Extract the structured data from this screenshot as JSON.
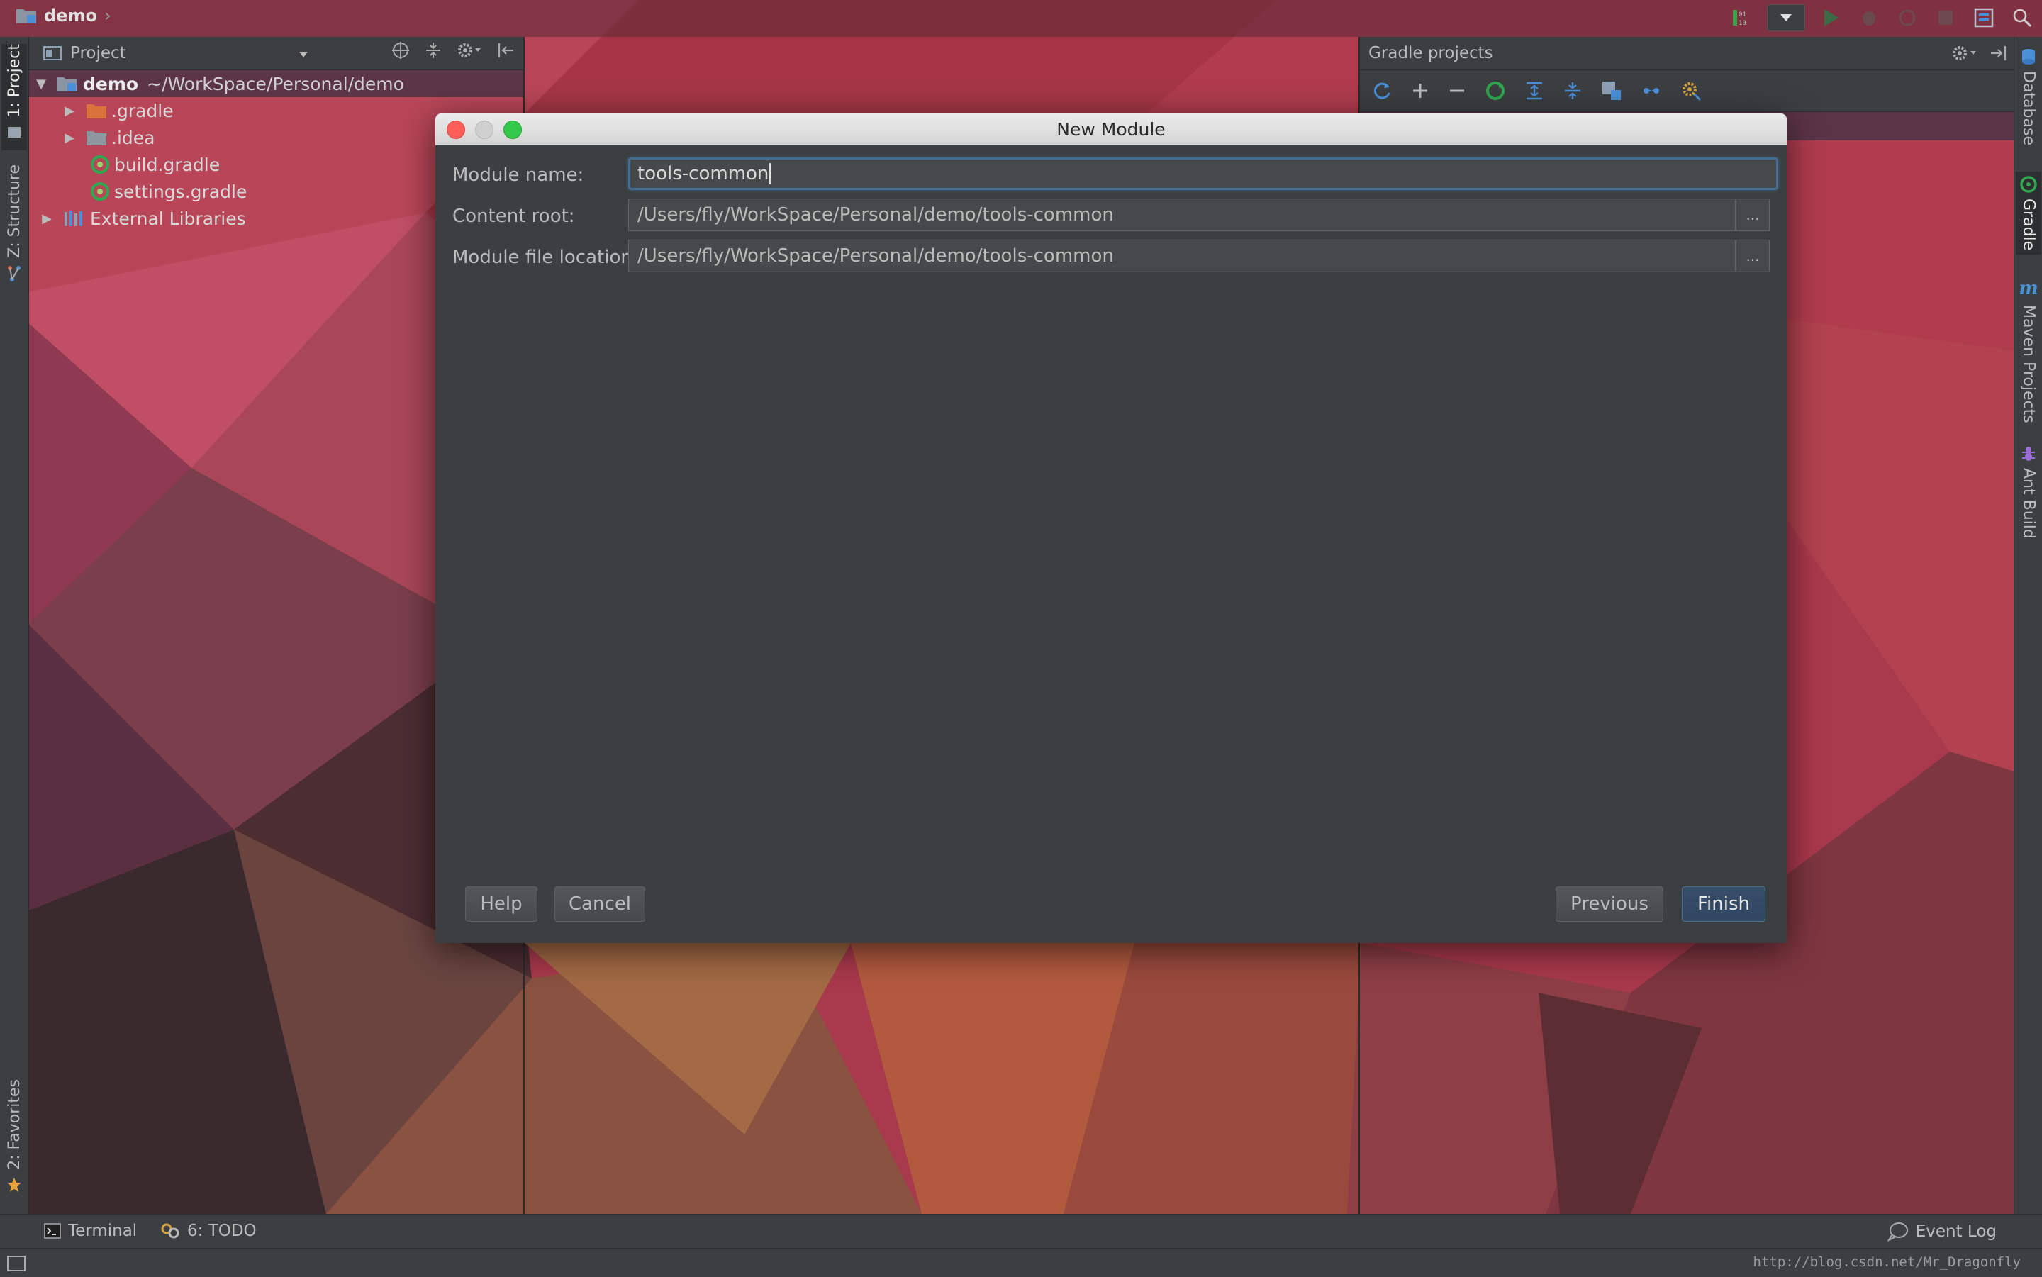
{
  "navbar": {
    "project_crumb": "demo"
  },
  "left_tabs": {
    "project": "1: Project",
    "structure": "Z: Structure",
    "favorites": "2: Favorites"
  },
  "right_tabs": {
    "database": "Database",
    "gradle": "Gradle",
    "maven": "Maven Projects",
    "ant": "Ant Build"
  },
  "project_panel": {
    "title": "Project",
    "tree": [
      {
        "label": "demo",
        "path": "~/WorkSpace/Personal/demo",
        "expanded": true,
        "icon": "module-folder-icon"
      },
      {
        "label": ".gradle",
        "icon": "orange-folder-icon"
      },
      {
        "label": ".idea",
        "icon": "gray-folder-icon"
      },
      {
        "label": "build.gradle",
        "icon": "gradle-file-icon"
      },
      {
        "label": "settings.gradle",
        "icon": "gradle-file-icon"
      },
      {
        "label": "External Libraries",
        "icon": "libraries-icon"
      }
    ]
  },
  "gradle_panel": {
    "title": "Gradle projects"
  },
  "dialog": {
    "title": "New Module",
    "module_name_label": "Module name:",
    "module_name_value": "tools-common",
    "content_root_label": "Content root:",
    "content_root_value": "/Users/fly/WorkSpace/Personal/demo/tools-common",
    "module_file_label": "Module file location:",
    "module_file_value": "/Users/fly/WorkSpace/Personal/demo/tools-common",
    "browse_label": "...",
    "help_label": "Help",
    "cancel_label": "Cancel",
    "previous_label": "Previous",
    "finish_label": "Finish"
  },
  "bottom_bar": {
    "terminal": "Terminal",
    "todo": "6: TODO",
    "event_log": "Event Log"
  },
  "status_bar": {
    "watermark": "http://blog.csdn.net/Mr_Dragonfly"
  },
  "colors": {
    "accent_blue": "#466d94",
    "gradle_green": "#2fa84f",
    "panel_bg": "#3c3f41",
    "folder_orange": "#d9733b"
  }
}
